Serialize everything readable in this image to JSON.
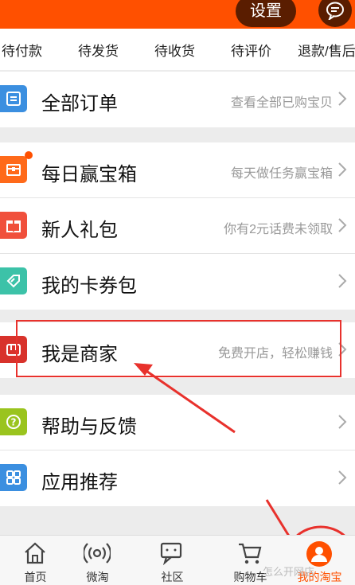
{
  "header": {
    "settings_label": "设置"
  },
  "order_tabs": [
    "待付款",
    "待发货",
    "待收货",
    "待评价",
    "退款/售后"
  ],
  "rows": {
    "all_orders": {
      "title": "全部订单",
      "hint": "查看全部已购宝贝"
    },
    "daily_box": {
      "title": "每日赢宝箱",
      "hint": "每天做任务赢宝箱"
    },
    "newbie_gift": {
      "title": "新人礼包",
      "hint": "你有2元话费未领取"
    },
    "coupons": {
      "title": "我的卡券包",
      "hint": ""
    },
    "merchant": {
      "title": "我是商家",
      "hint": "免费开店，轻松赚钱"
    },
    "help": {
      "title": "帮助与反馈",
      "hint": ""
    },
    "apps": {
      "title": "应用推荐",
      "hint": ""
    }
  },
  "bottom_nav": [
    {
      "label": "首页",
      "icon": "home-icon"
    },
    {
      "label": "微淘",
      "icon": "broadcast-icon"
    },
    {
      "label": "社区",
      "icon": "chat-icon"
    },
    {
      "label": "购物车",
      "icon": "cart-icon"
    },
    {
      "label": "我的淘宝",
      "icon": "user-icon",
      "active": true
    }
  ],
  "watermark": "怎么开网店",
  "colors": {
    "accent": "#ff5000",
    "annotation": "#e8312c"
  }
}
